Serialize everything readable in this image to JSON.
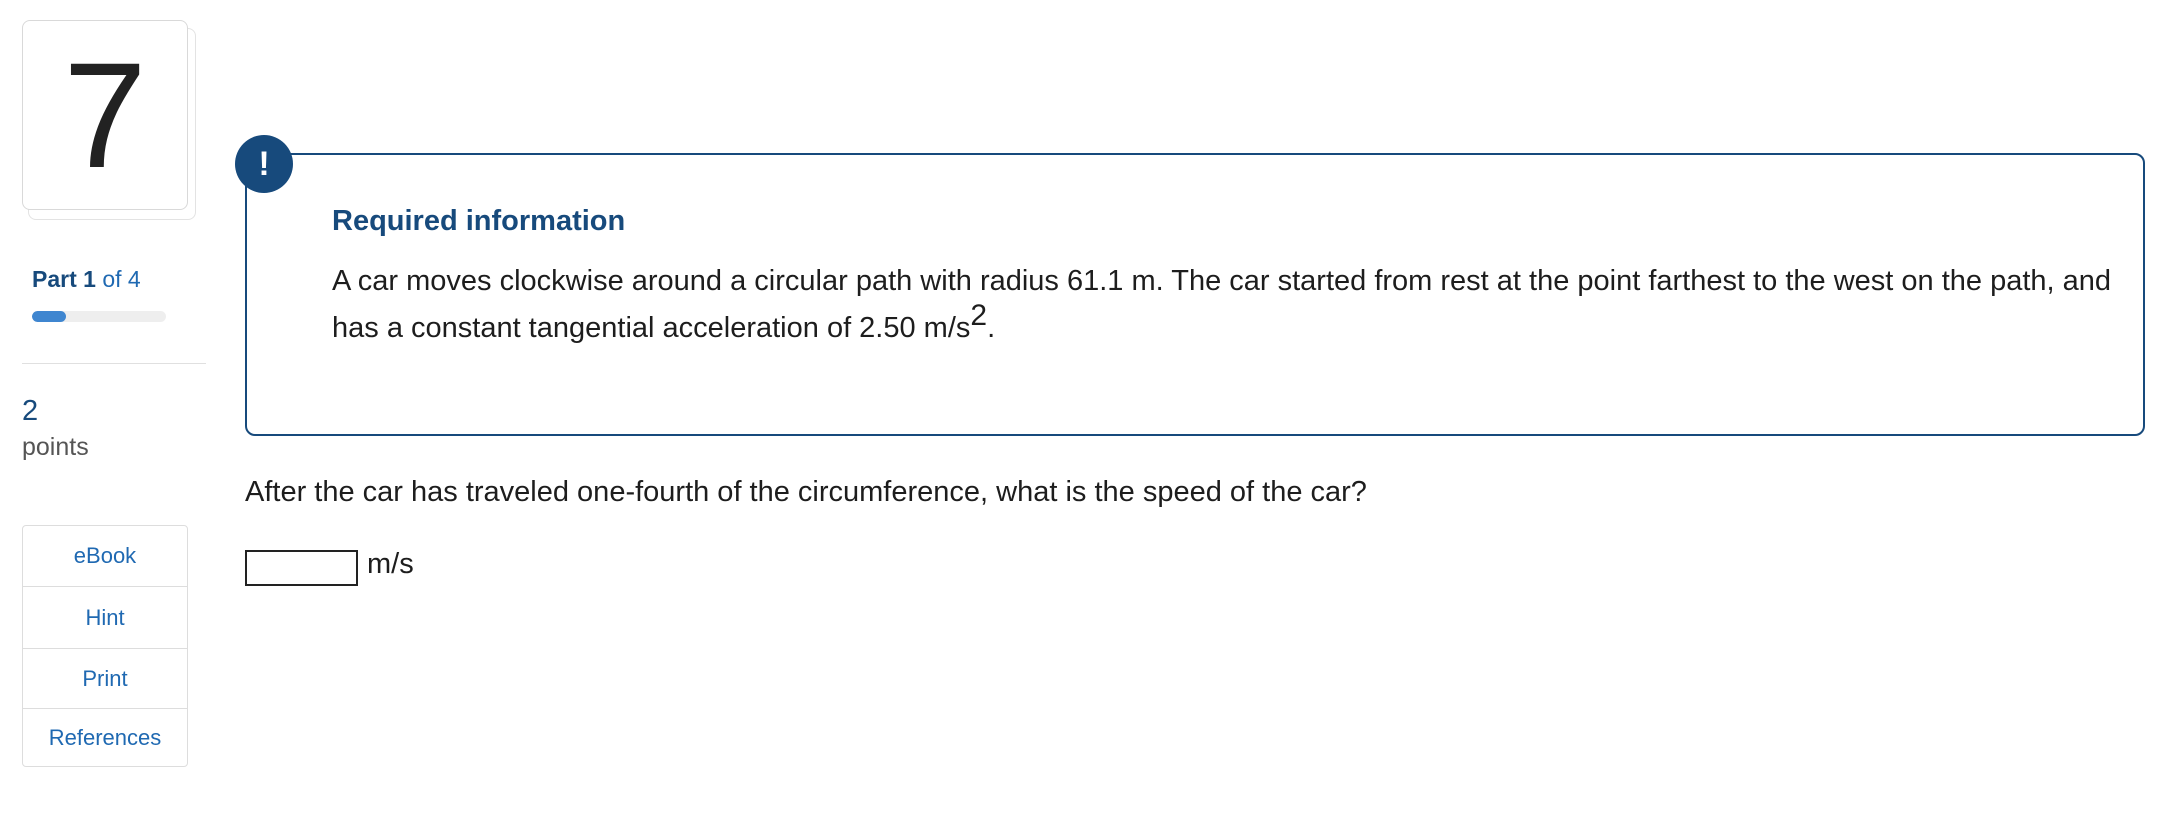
{
  "question": {
    "number": "7",
    "part": {
      "label": "Part",
      "current": "1",
      "of_text": "of 4",
      "progress_fraction": 0.25
    },
    "points": {
      "value": "2",
      "label": "points"
    }
  },
  "tools": [
    {
      "label": "eBook"
    },
    {
      "label": "Hint"
    },
    {
      "label": "Print"
    },
    {
      "label": "References"
    }
  ],
  "required_info": {
    "badge": "!",
    "title": "Required information",
    "text_main": "A car moves clockwise around a circular path with radius 61.1 m. The car started from rest at the point farthest to the west on the path, and has a constant tangential acceleration of 2.50 m/s",
    "text_sup": "2",
    "text_end": "."
  },
  "prompt": "After the car has traveled one-fourth of the circumference, what is the speed of the car?",
  "answer": {
    "value": "",
    "unit": "m/s"
  },
  "colors": {
    "accent": "#174a7c",
    "link": "#1f69b2",
    "progress": "#3f86d0"
  }
}
